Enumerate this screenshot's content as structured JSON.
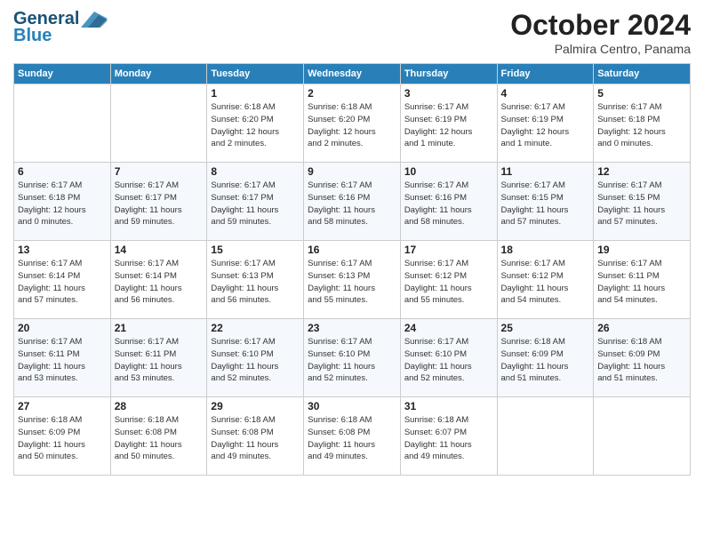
{
  "header": {
    "logo_general": "General",
    "logo_blue": "Blue",
    "month_title": "October 2024",
    "subtitle": "Palmira Centro, Panama"
  },
  "days_of_week": [
    "Sunday",
    "Monday",
    "Tuesday",
    "Wednesday",
    "Thursday",
    "Friday",
    "Saturday"
  ],
  "weeks": [
    [
      {
        "day": "",
        "info": ""
      },
      {
        "day": "",
        "info": ""
      },
      {
        "day": "1",
        "info": "Sunrise: 6:18 AM\nSunset: 6:20 PM\nDaylight: 12 hours\nand 2 minutes."
      },
      {
        "day": "2",
        "info": "Sunrise: 6:18 AM\nSunset: 6:20 PM\nDaylight: 12 hours\nand 2 minutes."
      },
      {
        "day": "3",
        "info": "Sunrise: 6:17 AM\nSunset: 6:19 PM\nDaylight: 12 hours\nand 1 minute."
      },
      {
        "day": "4",
        "info": "Sunrise: 6:17 AM\nSunset: 6:19 PM\nDaylight: 12 hours\nand 1 minute."
      },
      {
        "day": "5",
        "info": "Sunrise: 6:17 AM\nSunset: 6:18 PM\nDaylight: 12 hours\nand 0 minutes."
      }
    ],
    [
      {
        "day": "6",
        "info": "Sunrise: 6:17 AM\nSunset: 6:18 PM\nDaylight: 12 hours\nand 0 minutes."
      },
      {
        "day": "7",
        "info": "Sunrise: 6:17 AM\nSunset: 6:17 PM\nDaylight: 11 hours\nand 59 minutes."
      },
      {
        "day": "8",
        "info": "Sunrise: 6:17 AM\nSunset: 6:17 PM\nDaylight: 11 hours\nand 59 minutes."
      },
      {
        "day": "9",
        "info": "Sunrise: 6:17 AM\nSunset: 6:16 PM\nDaylight: 11 hours\nand 58 minutes."
      },
      {
        "day": "10",
        "info": "Sunrise: 6:17 AM\nSunset: 6:16 PM\nDaylight: 11 hours\nand 58 minutes."
      },
      {
        "day": "11",
        "info": "Sunrise: 6:17 AM\nSunset: 6:15 PM\nDaylight: 11 hours\nand 57 minutes."
      },
      {
        "day": "12",
        "info": "Sunrise: 6:17 AM\nSunset: 6:15 PM\nDaylight: 11 hours\nand 57 minutes."
      }
    ],
    [
      {
        "day": "13",
        "info": "Sunrise: 6:17 AM\nSunset: 6:14 PM\nDaylight: 11 hours\nand 57 minutes."
      },
      {
        "day": "14",
        "info": "Sunrise: 6:17 AM\nSunset: 6:14 PM\nDaylight: 11 hours\nand 56 minutes."
      },
      {
        "day": "15",
        "info": "Sunrise: 6:17 AM\nSunset: 6:13 PM\nDaylight: 11 hours\nand 56 minutes."
      },
      {
        "day": "16",
        "info": "Sunrise: 6:17 AM\nSunset: 6:13 PM\nDaylight: 11 hours\nand 55 minutes."
      },
      {
        "day": "17",
        "info": "Sunrise: 6:17 AM\nSunset: 6:12 PM\nDaylight: 11 hours\nand 55 minutes."
      },
      {
        "day": "18",
        "info": "Sunrise: 6:17 AM\nSunset: 6:12 PM\nDaylight: 11 hours\nand 54 minutes."
      },
      {
        "day": "19",
        "info": "Sunrise: 6:17 AM\nSunset: 6:11 PM\nDaylight: 11 hours\nand 54 minutes."
      }
    ],
    [
      {
        "day": "20",
        "info": "Sunrise: 6:17 AM\nSunset: 6:11 PM\nDaylight: 11 hours\nand 53 minutes."
      },
      {
        "day": "21",
        "info": "Sunrise: 6:17 AM\nSunset: 6:11 PM\nDaylight: 11 hours\nand 53 minutes."
      },
      {
        "day": "22",
        "info": "Sunrise: 6:17 AM\nSunset: 6:10 PM\nDaylight: 11 hours\nand 52 minutes."
      },
      {
        "day": "23",
        "info": "Sunrise: 6:17 AM\nSunset: 6:10 PM\nDaylight: 11 hours\nand 52 minutes."
      },
      {
        "day": "24",
        "info": "Sunrise: 6:17 AM\nSunset: 6:10 PM\nDaylight: 11 hours\nand 52 minutes."
      },
      {
        "day": "25",
        "info": "Sunrise: 6:18 AM\nSunset: 6:09 PM\nDaylight: 11 hours\nand 51 minutes."
      },
      {
        "day": "26",
        "info": "Sunrise: 6:18 AM\nSunset: 6:09 PM\nDaylight: 11 hours\nand 51 minutes."
      }
    ],
    [
      {
        "day": "27",
        "info": "Sunrise: 6:18 AM\nSunset: 6:09 PM\nDaylight: 11 hours\nand 50 minutes."
      },
      {
        "day": "28",
        "info": "Sunrise: 6:18 AM\nSunset: 6:08 PM\nDaylight: 11 hours\nand 50 minutes."
      },
      {
        "day": "29",
        "info": "Sunrise: 6:18 AM\nSunset: 6:08 PM\nDaylight: 11 hours\nand 49 minutes."
      },
      {
        "day": "30",
        "info": "Sunrise: 6:18 AM\nSunset: 6:08 PM\nDaylight: 11 hours\nand 49 minutes."
      },
      {
        "day": "31",
        "info": "Sunrise: 6:18 AM\nSunset: 6:07 PM\nDaylight: 11 hours\nand 49 minutes."
      },
      {
        "day": "",
        "info": ""
      },
      {
        "day": "",
        "info": ""
      }
    ]
  ]
}
